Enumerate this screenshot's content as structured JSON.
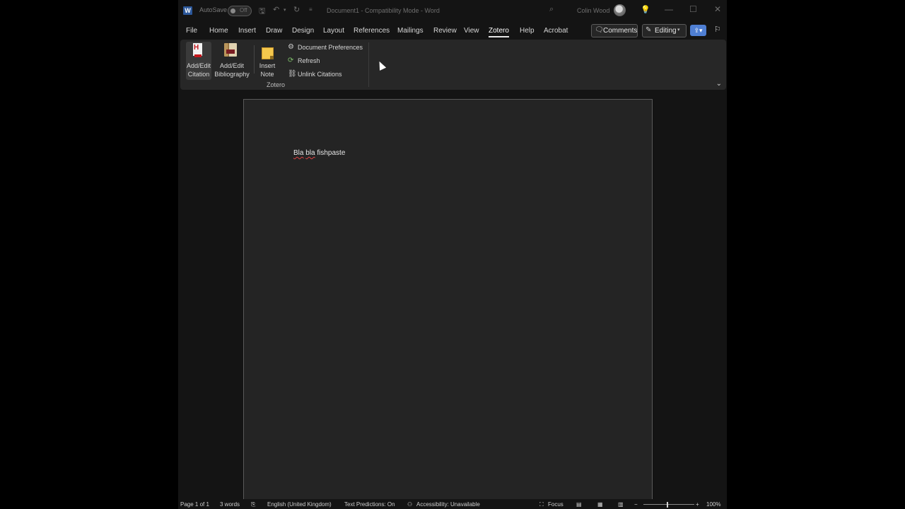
{
  "titlebar": {
    "autosave_label": "AutoSave",
    "autosave_state": "Off",
    "document_title": "Document1  -  Compatibility Mode  -  Word",
    "user_name": "Colin Wood",
    "icons": {
      "app": "word-icon",
      "save": "save-icon",
      "undo": "undo-icon",
      "redo": "redo-icon",
      "customize": "customize-qat-icon",
      "search": "search-icon",
      "lightbulb": "lightbulb-icon",
      "minimize": "minimize-icon",
      "maximize": "maximize-icon",
      "close": "close-icon"
    }
  },
  "tabs": [
    "File",
    "Home",
    "Insert",
    "Draw",
    "Design",
    "Layout",
    "References",
    "Mailings",
    "Review",
    "View",
    "Zotero",
    "Help",
    "Acrobat"
  ],
  "active_tab": "Zotero",
  "header_actions": {
    "comments_label": "Comments",
    "editing_label": "Editing"
  },
  "ribbon": {
    "add_edit_citation": {
      "line1": "Add/Edit",
      "line2": "Citation"
    },
    "add_edit_bibliography": {
      "line1": "Add/Edit",
      "line2": "Bibliography"
    },
    "insert_note": {
      "line1": "Insert",
      "line2": "Note"
    },
    "document_preferences": "Document Preferences",
    "refresh": "Refresh",
    "unlink_citations": "Unlink Citations",
    "group_label": "Zotero"
  },
  "document": {
    "word1": "Bla",
    "word2": "bla",
    "word3": "fishpaste"
  },
  "statusbar": {
    "page": "Page 1 of 1",
    "words": "3 words",
    "language": "English (United Kingdom)",
    "text_predictions": "Text Predictions: On",
    "accessibility": "Accessibility: Unavailable",
    "focus": "Focus",
    "zoom_minus": "−",
    "zoom_plus": "+",
    "zoom": "100%",
    "zoom_level": 1.0
  },
  "colors": {
    "window_bg": "#141414",
    "ribbon_bg": "#272727",
    "page_bg": "#242424",
    "share_button": "#4f7fd3",
    "spelling_squiggle": "#e04343"
  }
}
